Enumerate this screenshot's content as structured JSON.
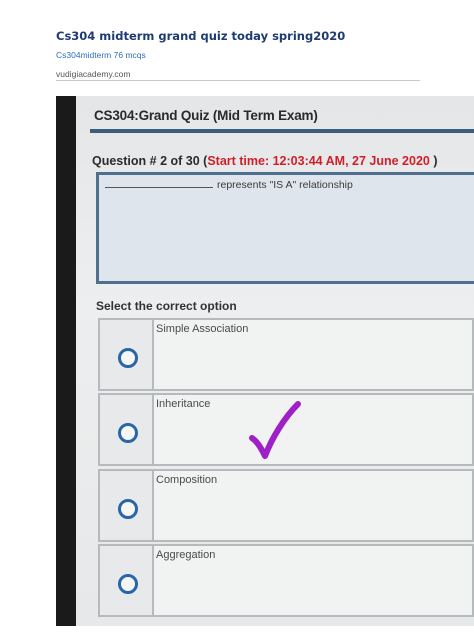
{
  "page": {
    "title": "Cs304 midterm grand quiz today spring2020",
    "subtitle": "Cs304midterm 76 mcqs",
    "site": "vudigiacademy.com"
  },
  "quiz": {
    "title": "CS304:Grand Quiz (Mid Term Exam)",
    "question_prefix": "Question # 2 of 30 (",
    "start_time": "Start time: 12:03:44 AM, 27 June 2020",
    "question_suffix": ")",
    "question_text": "represents \"IS A\" relationship",
    "select_label": "Select the correct option",
    "options": [
      {
        "label": "Simple Association",
        "selected": false
      },
      {
        "label": "Inheritance",
        "selected": false,
        "marked_correct": true
      },
      {
        "label": "Composition",
        "selected": false
      },
      {
        "label": "Aggregation",
        "selected": false
      }
    ]
  },
  "icons": {
    "check_mark": "checkmark-icon",
    "check_color": "#a020c8"
  },
  "colors": {
    "accent_red": "#d11f2a",
    "radio_blue": "#2767a7",
    "title_blue": "#1f3b73"
  }
}
